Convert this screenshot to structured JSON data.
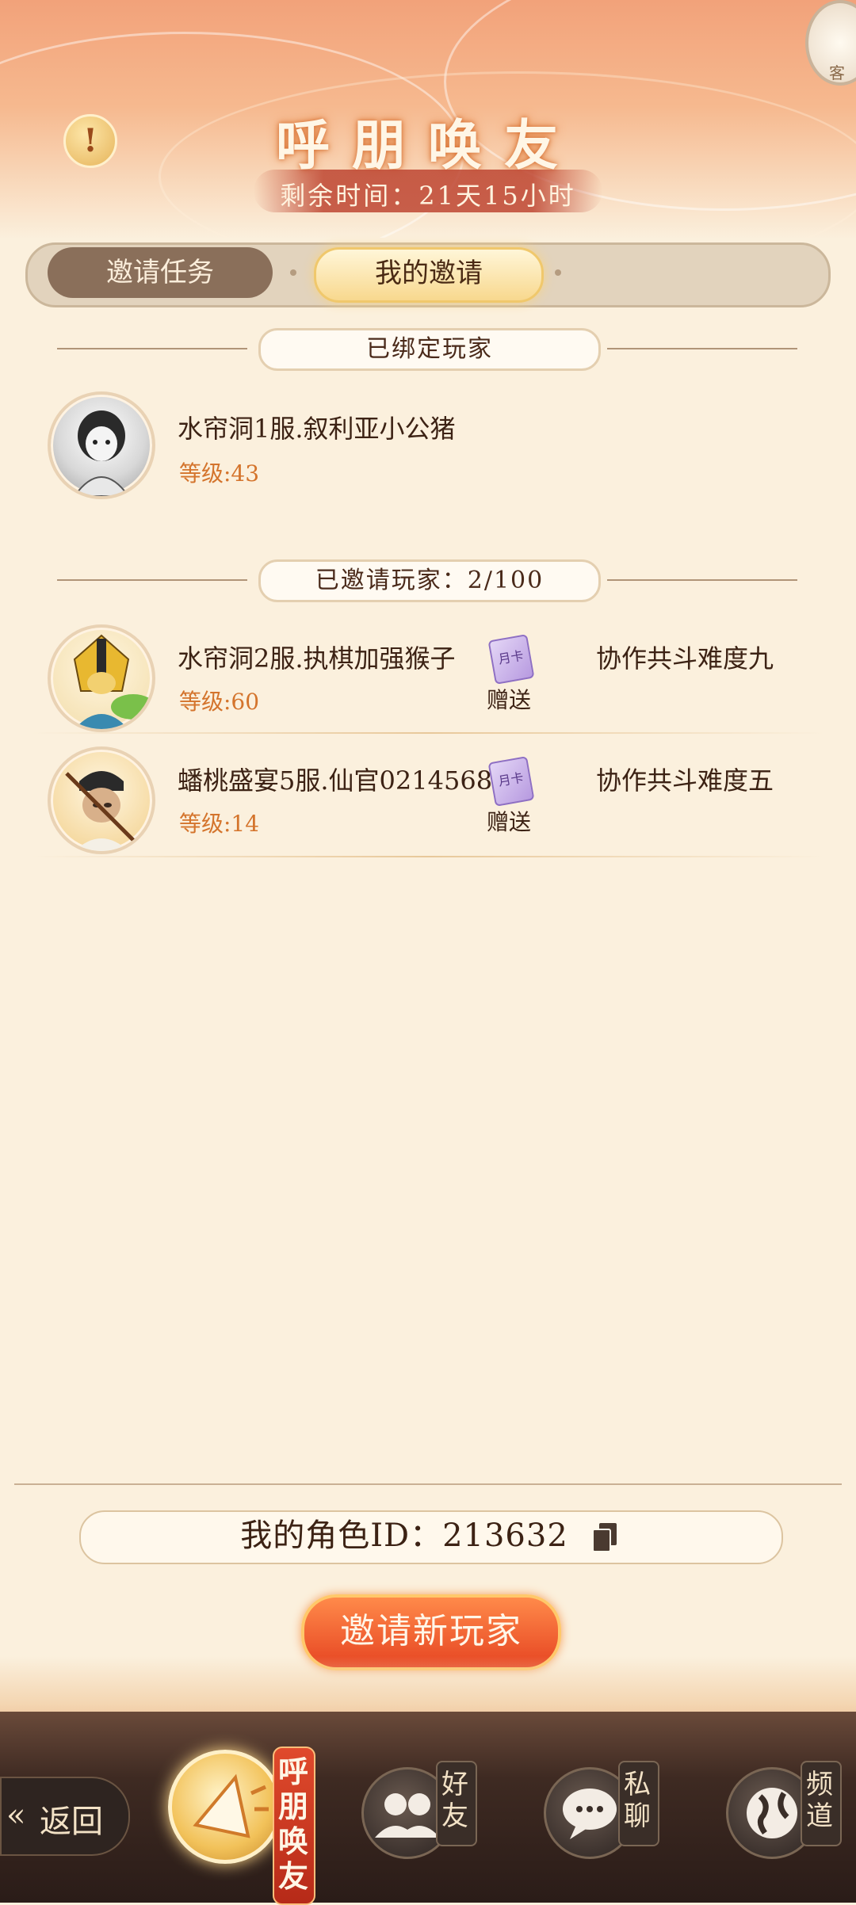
{
  "header": {
    "title": "呼朋唤友",
    "remaining_time": "剩余时间：21天15小时",
    "customer_service_label": "客"
  },
  "tabs": {
    "invite_tasks": "邀请任务",
    "my_invites": "我的邀请"
  },
  "bound_section": {
    "title": "已绑定玩家",
    "player": {
      "name": "水帘洞1服.叙利亚小公猪",
      "level": "等级:43"
    }
  },
  "invited_section": {
    "title": "已邀请玩家：2/100",
    "players": [
      {
        "name": "水帘洞2服.执棋加强猴子",
        "level": "等级:60",
        "gift_icon": "月卡",
        "gift_label": "赠送",
        "task": "协作共斗难度九"
      },
      {
        "name": "蟠桃盛宴5服.仙官0214568",
        "level": "等级:14",
        "gift_icon": "月卡",
        "gift_label": "赠送",
        "task": "协作共斗难度五"
      }
    ]
  },
  "footer": {
    "role_id": "我的角色ID：213632",
    "invite_button": "邀请新玩家"
  },
  "nav": {
    "back": "返回",
    "active": "呼朋唤友",
    "friends": "好友",
    "private_chat": "私聊",
    "channel": "频道"
  },
  "colors": {
    "accent": "#e64522",
    "level": "#d4742c",
    "background": "#fbf0dd"
  }
}
